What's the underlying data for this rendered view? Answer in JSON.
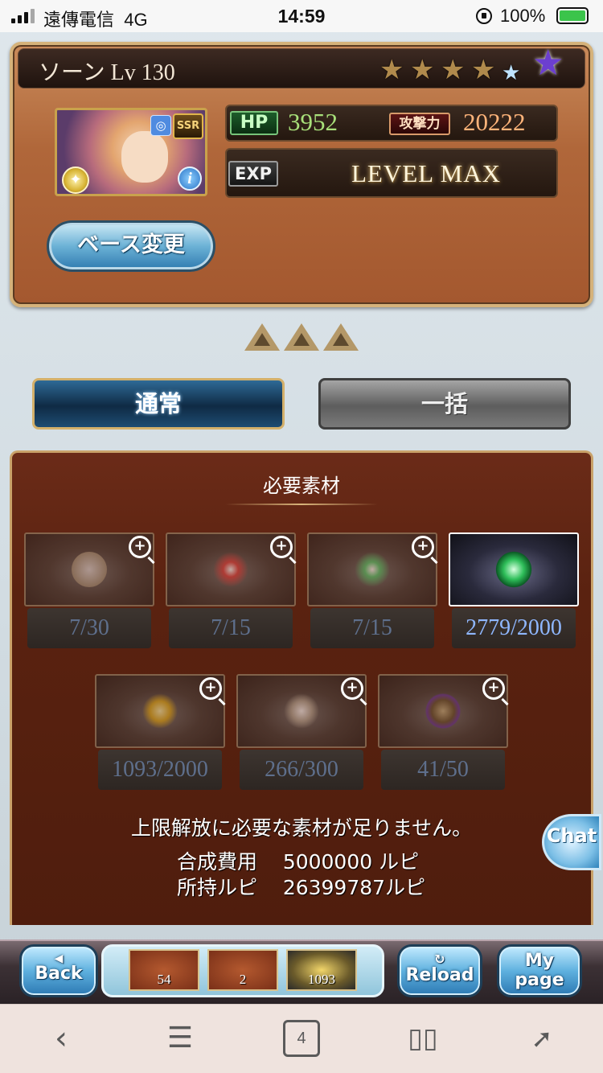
{
  "status_bar": {
    "carrier": "遠傳電信",
    "network": "4G",
    "time": "14:59",
    "battery": "100%"
  },
  "character": {
    "name": "ソーン",
    "level_label": "Lv",
    "level": "130",
    "rarity": "SSR",
    "stars": {
      "filled": 4,
      "empty": 1,
      "total": 6
    },
    "hp_label": "HP",
    "hp": "3952",
    "atk_label": "攻撃力",
    "atk": "20222",
    "exp_label": "EXP",
    "exp_status": "LEVEL MAX",
    "base_change_label": "ベース変更"
  },
  "tabs": [
    {
      "label": "通常",
      "active": true
    },
    {
      "label": "一括",
      "active": false
    }
  ],
  "materials": {
    "title": "必要素材",
    "items": [
      {
        "count": "7/30",
        "sufficient": false,
        "icon": "weapon-emblem-icon"
      },
      {
        "count": "7/15",
        "sufficient": false,
        "icon": "red-orb-icon"
      },
      {
        "count": "7/15",
        "sufficient": false,
        "icon": "green-orb-icon"
      },
      {
        "count": "2779/2000",
        "sufficient": true,
        "icon": "green-crystal-icon"
      },
      {
        "count": "1093/2000",
        "sufficient": false,
        "icon": "gold-ring-icon"
      },
      {
        "count": "266/300",
        "sufficient": false,
        "icon": "silver-emblem-icon"
      },
      {
        "count": "41/50",
        "sufficient": false,
        "icon": "dark-shell-icon"
      }
    ],
    "notice": "上限解放に必要な素材が足りません。",
    "cost_label": "合成費用",
    "cost_value": "5000000 ルピ",
    "owned_label": "所持ルピ",
    "owned_value": "26399787ルピ"
  },
  "chat_label": "Chat",
  "game_nav": {
    "back": "Back",
    "reload": "Reload",
    "my_line1": "My",
    "my_line2": "page",
    "items": [
      {
        "count": "54",
        "icon": "dark-crystal-icon"
      },
      {
        "count": "2",
        "icon": "potion-icon"
      },
      {
        "count": "1093",
        "icon": "gold-ring-icon"
      }
    ]
  },
  "browser": {
    "tab_count": "4"
  },
  "colors": {
    "accent": "#d5b27a",
    "panel": "#b0673a",
    "materials_bg": "#5a2210",
    "sufficient_text": "#8fb7ff",
    "insufficient_text": "#5e6f8c"
  }
}
